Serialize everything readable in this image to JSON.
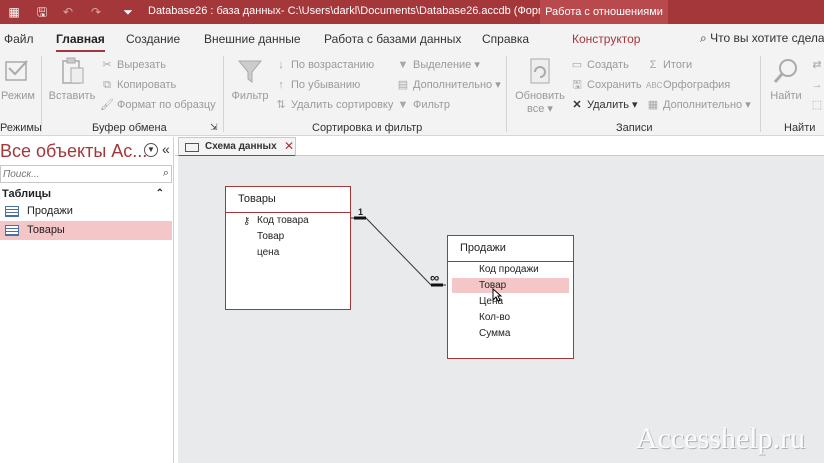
{
  "titlebar": {
    "title": "Database26 : база данных- C:\\Users\\darkl\\Documents\\Database26.accdb (Форм...",
    "context_group": "Работа с отношениями",
    "accent_color": "#a4373a"
  },
  "tabs": {
    "file": "Файл",
    "home": "Главная",
    "create": "Создание",
    "external": "Внешние данные",
    "dbtools": "Работа с базами данных",
    "help": "Справка",
    "design": "Конструктор",
    "tell_me": "Что вы хотите сдела"
  },
  "ribbon": {
    "views": {
      "mode": "Режим",
      "group": "Режимы"
    },
    "clipboard": {
      "paste": "Вставить",
      "cut": "Вырезать",
      "copy": "Копировать",
      "format_painter": "Формат по образцу",
      "group": "Буфер обмена"
    },
    "sort_filter": {
      "filter": "Фильтр",
      "ascending": "По возрастанию",
      "descending": "По убыванию",
      "remove_sort": "Удалить сортировку",
      "selection": "Выделение",
      "advanced": "Дополнительно",
      "toggle_filter": "Фильтр",
      "group": "Сортировка и фильтр"
    },
    "records": {
      "refresh": "Обновить",
      "refresh_sub": "все",
      "new": "Создать",
      "save": "Сохранить",
      "delete": "Удалить",
      "totals": "Итоги",
      "spelling": "Орфография",
      "more": "Дополнительно",
      "group": "Записи"
    },
    "find": {
      "find": "Найти",
      "group": "Найти"
    }
  },
  "nav": {
    "title": "Все объекты Ac...",
    "search_placeholder": "Поиск...",
    "group": "Таблицы",
    "items": [
      {
        "label": "Продажи"
      },
      {
        "label": "Товары"
      }
    ]
  },
  "document": {
    "tab_label": "Схема данных"
  },
  "tables": [
    {
      "name": "Товары",
      "fields": [
        "Код товара",
        "Товар",
        "цена"
      ]
    },
    {
      "name": "Продажи",
      "fields": [
        "Код продажи",
        "Товар",
        "Цена",
        "Кол-во",
        "Сумма"
      ]
    }
  ],
  "relationship": {
    "one_side": "1",
    "many_side": "∞"
  },
  "watermark": "Accesshelp.ru"
}
